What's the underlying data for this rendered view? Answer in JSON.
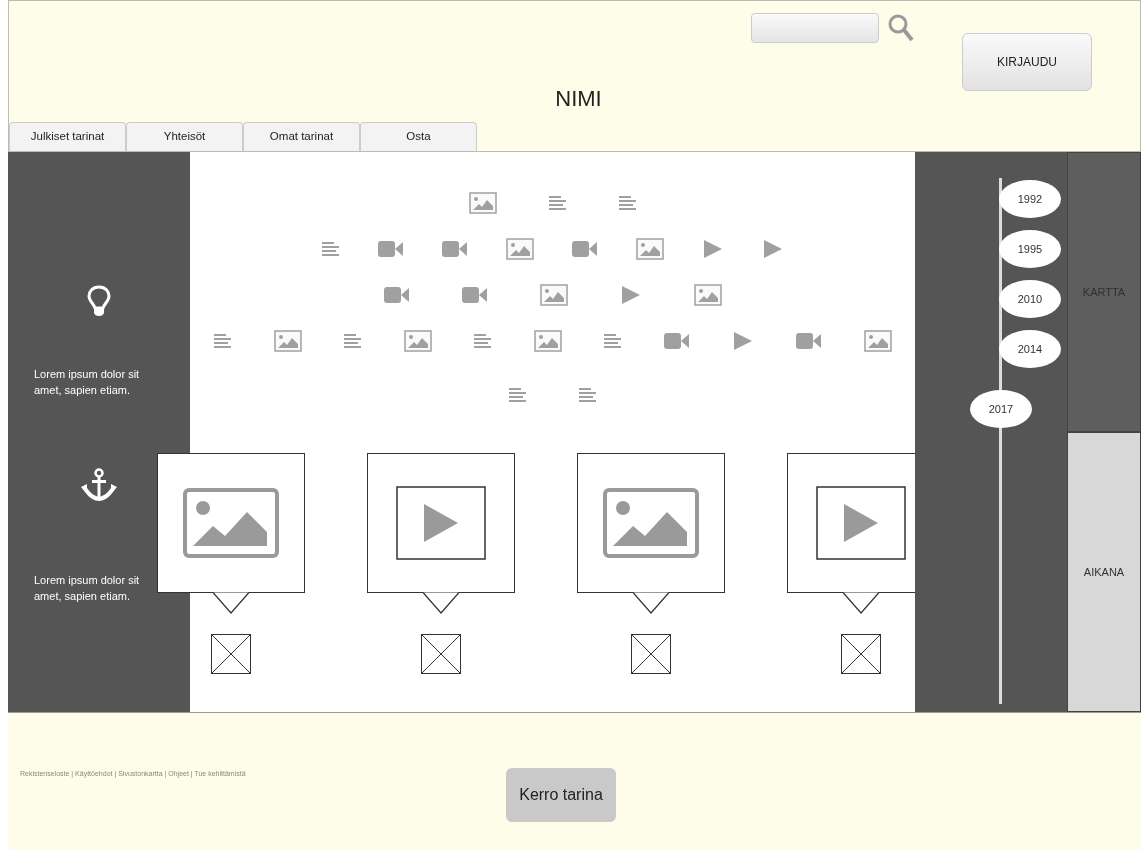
{
  "header": {
    "title": "NIMI",
    "login_button": "KIRJAUDU"
  },
  "tabs": [
    {
      "label": "Julkiset tarinat",
      "selected": false
    },
    {
      "label": "Yhteisöt",
      "selected": false
    },
    {
      "label": "Omat tarinat",
      "selected": false
    },
    {
      "label": "Osta",
      "selected": false
    }
  ],
  "sidebar": [
    {
      "kind": "bulb",
      "text": "Lorem ipsum dolor sit amet, sapien etiam."
    },
    {
      "kind": "anchor",
      "text": "Lorem ipsum dolor sit amet, sapien etiam."
    }
  ],
  "media_cloud": [
    {
      "items": [
        {
          "kind": "image"
        },
        {
          "kind": "text"
        },
        {
          "kind": "text"
        }
      ]
    },
    {
      "items": [
        {
          "kind": "text"
        },
        {
          "kind": "video"
        },
        {
          "kind": "video"
        },
        {
          "kind": "image"
        },
        {
          "kind": "video"
        },
        {
          "kind": "image"
        },
        {
          "kind": "play"
        },
        {
          "kind": "play"
        }
      ]
    },
    {
      "items": [
        {
          "kind": "video"
        },
        {
          "kind": "video"
        },
        {
          "kind": "image"
        },
        {
          "kind": "play"
        },
        {
          "kind": "image"
        }
      ]
    },
    {
      "items": [
        {
          "kind": "text"
        },
        {
          "kind": "image"
        },
        {
          "kind": "text"
        },
        {
          "kind": "image"
        },
        {
          "kind": "text"
        },
        {
          "kind": "image"
        },
        {
          "kind": "text"
        },
        {
          "kind": "video"
        },
        {
          "kind": "play"
        },
        {
          "kind": "video"
        },
        {
          "kind": "image"
        }
      ]
    },
    {
      "items": [
        {
          "kind": "text"
        },
        {
          "kind": "text"
        }
      ]
    }
  ],
  "cards": [
    {
      "kind": "image"
    },
    {
      "kind": "video"
    },
    {
      "kind": "image"
    },
    {
      "kind": "video"
    }
  ],
  "timeline": [
    {
      "year": "1992",
      "selected": false
    },
    {
      "year": "1995",
      "selected": false
    },
    {
      "year": "2010",
      "selected": false
    },
    {
      "year": "2014",
      "selected": false
    },
    {
      "year": "2017",
      "selected": true
    }
  ],
  "view_tabs": [
    {
      "label": "KARTTA",
      "selected": false
    },
    {
      "label": "AIKANA",
      "selected": true
    }
  ],
  "footer": {
    "links": "Rekisteriseloste | Käyttöehdot | Sivustonkartta | Ohjeet | Tue kehittämistä",
    "button": "Kerro tarina"
  }
}
